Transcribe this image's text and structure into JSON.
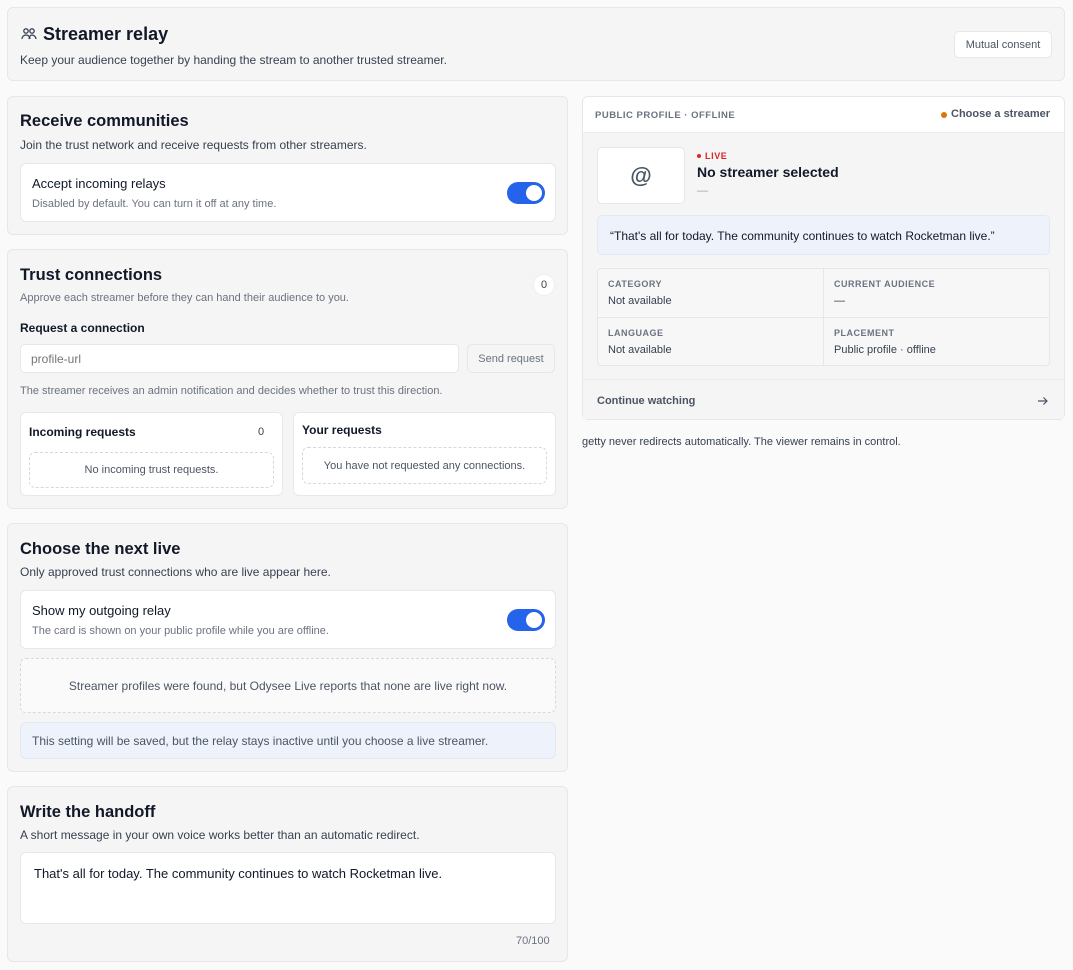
{
  "header": {
    "title": "Streamer relay",
    "subtitle": "Keep your audience together by handing the stream to another trusted streamer.",
    "badge": "Mutual consent"
  },
  "receive": {
    "title": "Receive communities",
    "subtitle": "Join the trust network and receive requests from other streamers.",
    "toggle_label": "Accept incoming relays",
    "toggle_help": "Disabled by default. You can turn it off at any time.",
    "toggle_on": true
  },
  "trust": {
    "title": "Trust connections",
    "subtitle": "Approve each streamer before they can hand their audience to you.",
    "count": "0",
    "request_heading": "Request a connection",
    "input_placeholder": "profile-url",
    "send_label": "Send request",
    "note": "The streamer receives an admin notification and decides whether to trust this direction.",
    "incoming_title": "Incoming requests",
    "incoming_count": "0",
    "incoming_empty": "No incoming trust requests.",
    "yours_title": "Your requests",
    "yours_empty": "You have not requested any connections."
  },
  "next_live": {
    "title": "Choose the next live",
    "subtitle": "Only approved trust connections who are live appear here.",
    "toggle_label": "Show my outgoing relay",
    "toggle_help": "The card is shown on your public profile while you are offline.",
    "toggle_on": true,
    "empty": "Streamer profiles were found, but Odysee Live reports that none are live right now.",
    "info": "This setting will be saved, but the relay stays inactive until you choose a live streamer."
  },
  "handoff": {
    "title": "Write the handoff",
    "subtitle": "A short message in your own voice works better than an automatic redirect.",
    "message": "That's all for today. The community continues to watch Rocketman live.",
    "counter": "70/100"
  },
  "preview": {
    "header_label": "PUBLIC PROFILE · OFFLINE",
    "status": "Choose a streamer",
    "status_color": "#d97706",
    "avatar_symbol": "@",
    "live_label": "LIVE",
    "live_color": "#dc2626",
    "name": "No streamer selected",
    "handle": "—",
    "quote": "“That's all for today. The community continues to watch Rocketman live.”",
    "grid": [
      {
        "label": "CATEGORY",
        "value": "Not available"
      },
      {
        "label": "CURRENT AUDIENCE",
        "value": "—"
      },
      {
        "label": "LANGUAGE",
        "value": "Not available"
      },
      {
        "label": "PLACEMENT",
        "value": "Public profile · offline"
      }
    ],
    "cta": "Continue watching",
    "footnote": "getty never redirects automatically. The viewer remains in control."
  },
  "colors": {
    "accent": "#2563eb",
    "panel_bg": "#f5f5f5"
  }
}
